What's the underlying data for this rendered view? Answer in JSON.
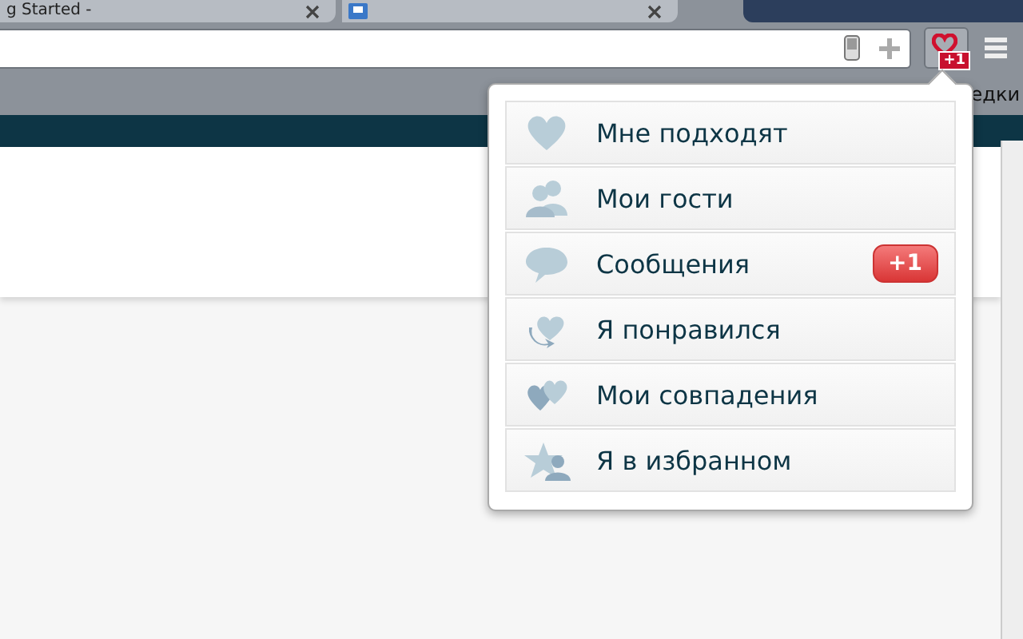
{
  "tabs": [
    {
      "kind": "text",
      "label": "g Started -"
    },
    {
      "kind": "icon"
    }
  ],
  "extension": {
    "badge": "+1"
  },
  "bookmarks_bar": {
    "text": "едки"
  },
  "popup": {
    "items": [
      {
        "label": "Мне подходят"
      },
      {
        "label": "Мои гости"
      },
      {
        "label": "Сообщения",
        "badge": "+1"
      },
      {
        "label": "Я понравился"
      },
      {
        "label": "Мои совпадения"
      },
      {
        "label": "Я в избранном"
      }
    ]
  }
}
